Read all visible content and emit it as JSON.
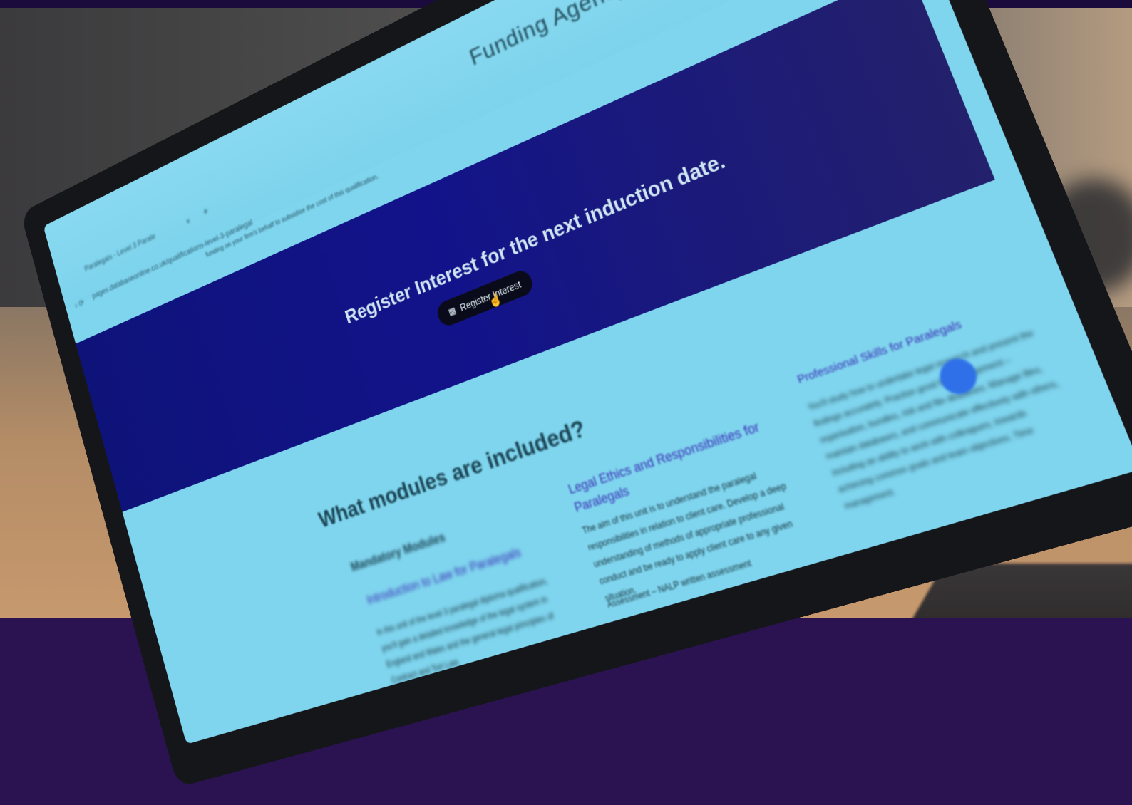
{
  "browser": {
    "tab_label": "Paralegals - Level 3 Parale",
    "tab_close": "×",
    "new_tab": "+",
    "nav_icons": "‹  ⟳",
    "url": "pages.databaseonline.co.uk/qualifications-level-3-paralegal"
  },
  "page": {
    "agency_heading": "Funding Agency",
    "funding_note": "funding on your firm's behalf to subsidise the cost of this qualification."
  },
  "banner": {
    "title": "Register Interest for the next induction date.",
    "cta_label": "Register Interest",
    "cta_icon": "calendar-icon"
  },
  "modules": {
    "heading": "What modules are included?",
    "mandatory_label": "Mandatory Modules",
    "columns": [
      {
        "title": "Introduction to Law for Paralegals",
        "body": "In this unit of the level 3 paralegal diploma qualification, you'll gain a detailed knowledge of the legal system in England and Wales and the general legal principles of Contract and Tort Law."
      },
      {
        "title": "Legal Ethics and Responsibilities for Paralegals",
        "body": "The aim of this unit is to understand the paralegal responsibilities in relation to client care. Develop a deep understanding of methods of appropriate professional conduct and be ready to apply client care to any given situation.",
        "assessment": "Assessment – NALP written assessment"
      },
      {
        "title": "Professional Skills for Paralegals",
        "body": "You'll study how to undertake legal research and present the findings accurately. Practise good file management – organisation, bundles, risk and file deadlines. Manage files, maintain databases, and communicate effectively with others, including an ability to work with colleagues, towards achieving common goals and team objectives. Time management."
      }
    ]
  },
  "colors": {
    "banner": "#12138a",
    "screen": "#7fd5ee",
    "cta": "#0a0b1a",
    "chat": "#2f6fe8"
  }
}
